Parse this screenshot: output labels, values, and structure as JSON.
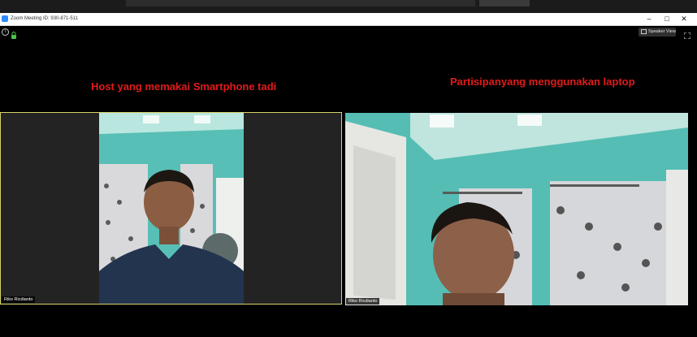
{
  "window": {
    "title": "Zoom Meeting ID: 930-871-511",
    "controls": [
      "–",
      "□",
      "✕"
    ]
  },
  "toolbar": {
    "view_label": "Speaker View"
  },
  "annotations": {
    "left": "Host yang memakai Smartphone tadi",
    "right": "Partisipanyang menggunakan laptop"
  },
  "participants": [
    {
      "name": "Riko Ricdianto"
    },
    {
      "name": "Riko Ricdianto"
    }
  ],
  "colors": {
    "annotation": "#e21b1b",
    "active_speaker_border": "#d8d36a",
    "zoom_blue": "#2d8cff"
  },
  "icons": [
    "info-icon",
    "lock-icon",
    "speaker-view-icon",
    "fullscreen-icon"
  ]
}
